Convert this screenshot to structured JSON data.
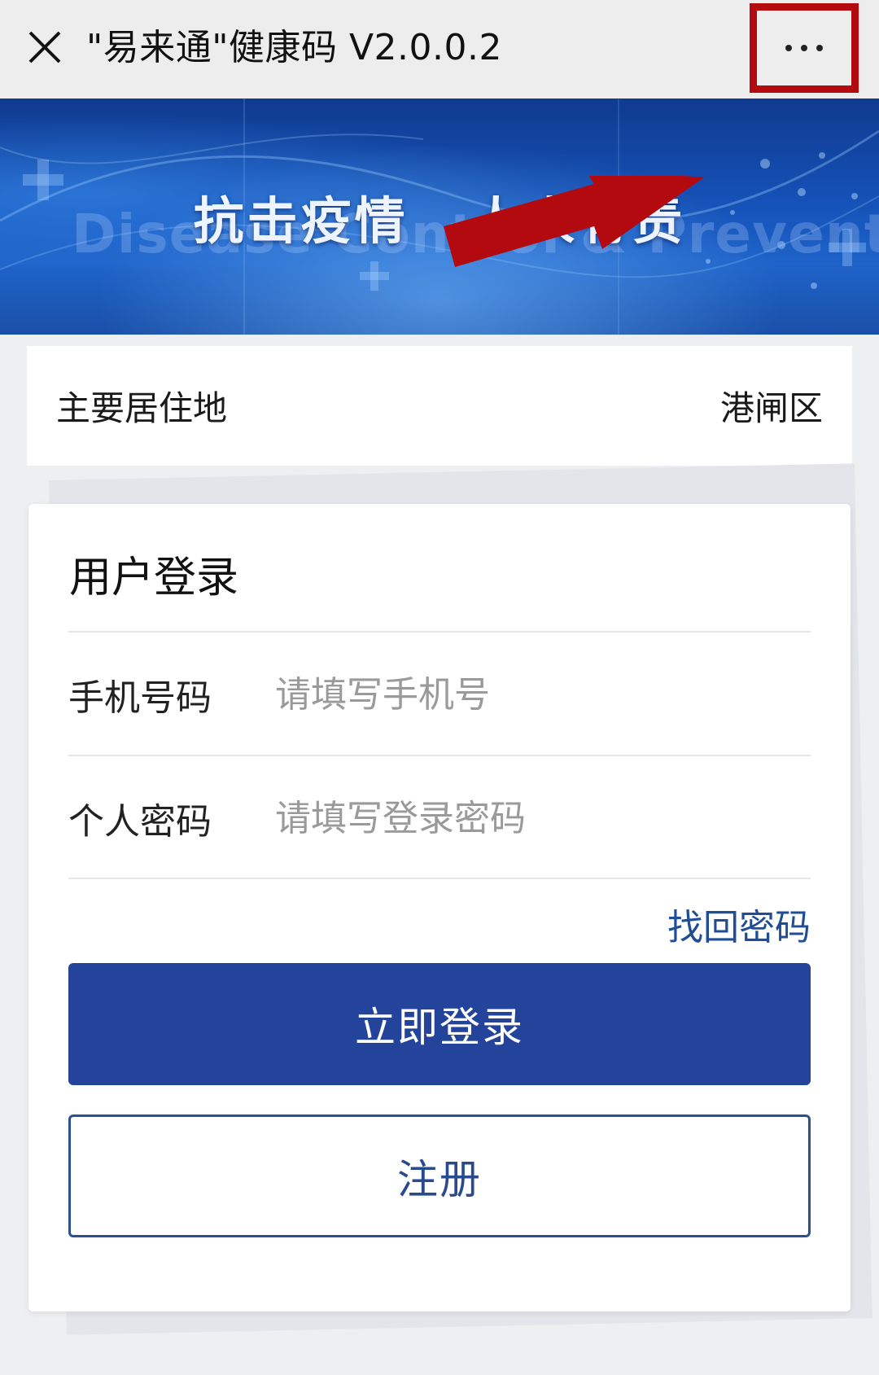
{
  "window": {
    "title": "\"易来通\"健康码 V2.0.0.2",
    "close_icon": "close-icon",
    "more_icon": "more-dots-icon"
  },
  "banner": {
    "slogan": "抗击疫情   人人有责",
    "watermark": "Disease Control & Prevention"
  },
  "residence": {
    "label": "主要居住地",
    "value": "港闸区"
  },
  "login": {
    "title": "用户登录",
    "phone": {
      "label": "手机号码",
      "value": "",
      "placeholder": "请填写手机号"
    },
    "password": {
      "label": "个人密码",
      "value": "",
      "placeholder": "请填写登录密码"
    },
    "forgot_password": "找回密码",
    "submit_label": "立即登录",
    "register_label": "注册"
  },
  "colors": {
    "accent": "#23449a",
    "highlight_annotation": "#b30a10",
    "link": "#1f4e96"
  }
}
